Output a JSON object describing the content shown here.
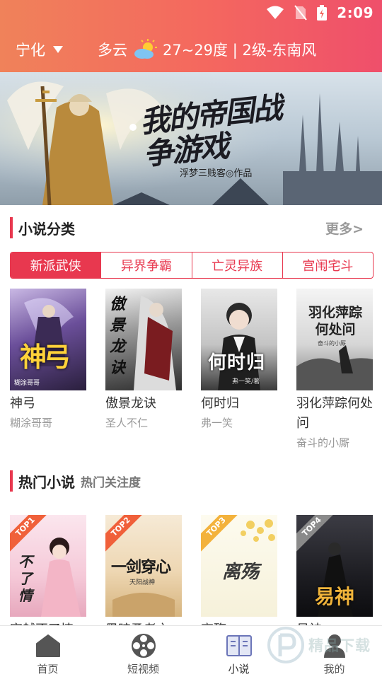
{
  "status": {
    "time": "2:09"
  },
  "header": {
    "city": "宁化",
    "weather": {
      "condition": "多云",
      "detail": "27~29度 | 2级-东南风"
    }
  },
  "banner": {
    "title": "我的帝国战争游戏",
    "subtitle": "浮梦三贱客◎作品"
  },
  "categories": {
    "title": "小说分类",
    "more_label": "更多>",
    "tabs": [
      {
        "label": "新派武侠",
        "active": true
      },
      {
        "label": "异界争霸",
        "active": false
      },
      {
        "label": "亡灵异族",
        "active": false
      },
      {
        "label": "宫闱宅斗",
        "active": false
      }
    ],
    "books": [
      {
        "title": "神弓",
        "author": "糊涂哥哥",
        "cover_text": "神弓",
        "cover_small": "糊涂哥哥"
      },
      {
        "title": "傲景龙诀",
        "author": "圣人不仁",
        "cover_text": "傲景龙诀"
      },
      {
        "title": "何时归",
        "author": "弗一笑",
        "cover_text": "何时归",
        "cover_small": "弗一笑/著"
      },
      {
        "title": "羽化萍踪何处问",
        "author": "奋斗的小厮",
        "cover_text": "羽化萍踪何处问",
        "cover_small": "奋斗的小厮"
      }
    ]
  },
  "hot": {
    "title": "热门小说",
    "subtitle": "热门关注度",
    "books": [
      {
        "rank": "TOP1",
        "title": "穿越不了情",
        "cover_text": "不了情"
      },
      {
        "rank": "TOP2",
        "title": "黑暗勇者之",
        "cover_text": "一剑穿心",
        "cover_small": "天阳战神"
      },
      {
        "rank": "TOP3",
        "title": "离殇",
        "cover_text": "离殇"
      },
      {
        "rank": "TOP4",
        "title": "易神",
        "cover_text": "易神"
      }
    ]
  },
  "tabbar": {
    "items": [
      {
        "label": "首页",
        "icon": "home-icon"
      },
      {
        "label": "短视频",
        "icon": "film-reel-icon"
      },
      {
        "label": "小说",
        "icon": "book-icon"
      },
      {
        "label": "我的",
        "icon": "user-icon"
      }
    ]
  },
  "watermark": {
    "text": "精品下载"
  },
  "colors": {
    "accent": "#e8384f",
    "header_start": "#f0825a",
    "header_end": "#ef4f6b"
  }
}
